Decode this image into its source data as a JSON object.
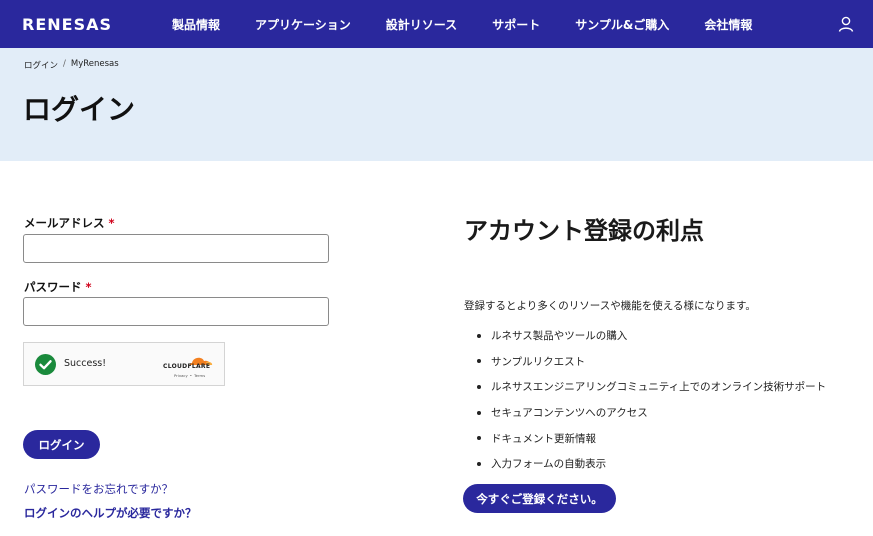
{
  "header": {
    "brand": "RENESAS",
    "nav": [
      "製品情報",
      "アプリケーション",
      "設計リソース",
      "サポート",
      "サンプル&ご購入",
      "会社情報"
    ],
    "user_icon": "user-icon"
  },
  "breadcrumb": [
    "ログイン",
    "MyRenesas"
  ],
  "page_title": "ログイン",
  "form": {
    "email_label": "メールアドレス",
    "email_value": "",
    "password_label": "パスワード",
    "password_value": "",
    "required_mark": "*",
    "captcha": {
      "status": "Success!",
      "provider": "CLOUDFLARE",
      "privacy": "Privacy",
      "dot": "•",
      "terms": "Terms"
    },
    "login_button": "ログイン",
    "forgot_password": "パスワードをお忘れですか？",
    "login_help": "ログインのヘルプが必要ですか？"
  },
  "benefits": {
    "title": "アカウント登録の利点",
    "intro": "登録するとより多くのリソースや機能を使える様になります。",
    "items": [
      "ルネサス製品やツールの購入",
      "サンプルリクエスト",
      "ルネサスエンジニアリングコミュニティ上でのオンライン技術サポート",
      "セキュアコンテンツへのアクセス",
      "ドキュメント更新情報",
      "入力フォームの自動表示"
    ],
    "register_button": "今すぐご登録ください。"
  },
  "colors": {
    "brand": "#2a289d",
    "hero_bg": "#e2edf8",
    "success": "#1a8a3c",
    "required": "#d0021b",
    "cloudflare_orange": "#f38020"
  }
}
